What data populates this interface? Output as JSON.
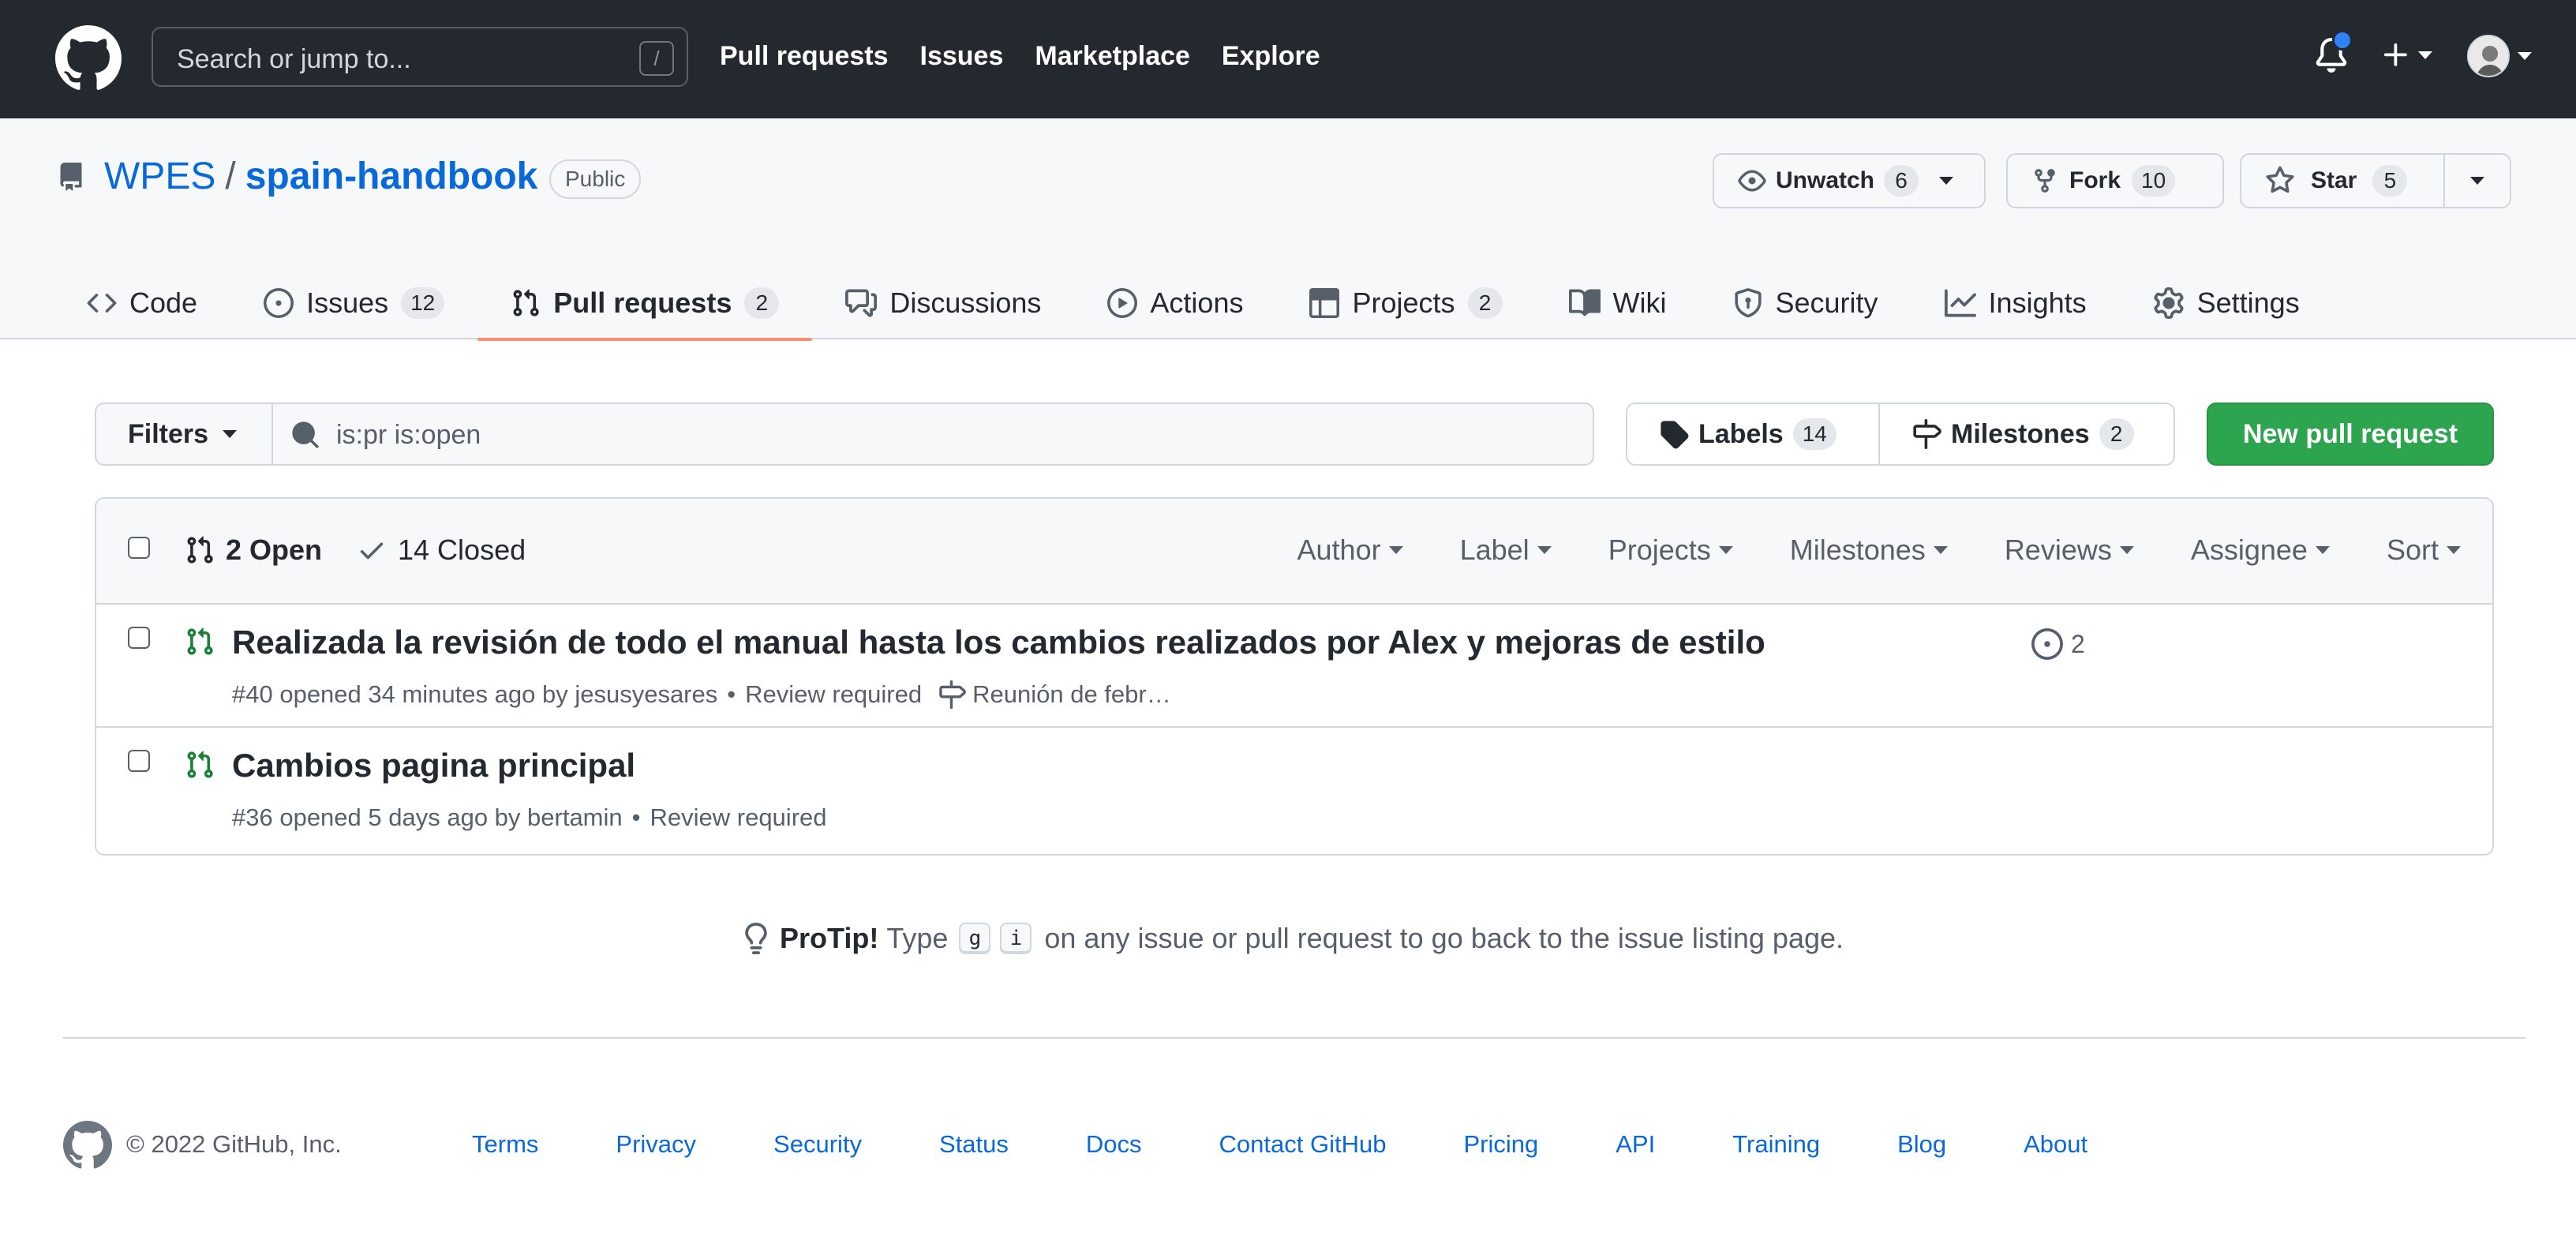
{
  "header": {
    "search_placeholder": "Search or jump to...",
    "search_shortcut": "/",
    "nav": [
      "Pull requests",
      "Issues",
      "Marketplace",
      "Explore"
    ]
  },
  "repo": {
    "owner": "WPES",
    "separator": "/",
    "name": "spain-handbook",
    "visibility": "Public",
    "watch": {
      "label": "Unwatch",
      "count": "6"
    },
    "fork": {
      "label": "Fork",
      "count": "10"
    },
    "star": {
      "label": "Star",
      "count": "5"
    }
  },
  "tabs": [
    {
      "label": "Code",
      "count": "",
      "icon": "code-icon"
    },
    {
      "label": "Issues",
      "count": "12",
      "icon": "issue-opened-icon"
    },
    {
      "label": "Pull requests",
      "count": "2",
      "icon": "git-pull-request-icon",
      "active": true
    },
    {
      "label": "Discussions",
      "count": "",
      "icon": "comment-discussion-icon"
    },
    {
      "label": "Actions",
      "count": "",
      "icon": "play-icon"
    },
    {
      "label": "Projects",
      "count": "2",
      "icon": "table-icon"
    },
    {
      "label": "Wiki",
      "count": "",
      "icon": "book-icon"
    },
    {
      "label": "Security",
      "count": "",
      "icon": "shield-icon"
    },
    {
      "label": "Insights",
      "count": "",
      "icon": "graph-icon"
    },
    {
      "label": "Settings",
      "count": "",
      "icon": "gear-icon"
    }
  ],
  "subnav": {
    "filters_label": "Filters",
    "query": "is:pr is:open",
    "labels": {
      "label": "Labels",
      "count": "14"
    },
    "milestones": {
      "label": "Milestones",
      "count": "2"
    },
    "new_pr_label": "New pull request"
  },
  "list": {
    "open_label": "2 Open",
    "closed_label": "14 Closed",
    "sort_menus": [
      "Author",
      "Label",
      "Projects",
      "Milestones",
      "Reviews",
      "Assignee",
      "Sort"
    ],
    "items": [
      {
        "title": "Realizada la revisión de todo el manual hasta los cambios realizados por Alex y mejoras de estilo",
        "meta": "#40 opened 34 minutes ago by jesusyesares",
        "review": "Review required",
        "milestone": "Reunión de febr…",
        "linked_issues": "2"
      },
      {
        "title": "Cambios pagina principal",
        "meta": "#36 opened 5 days ago by bertamin",
        "review": "Review required"
      }
    ]
  },
  "protip": {
    "label": "ProTip!",
    "before": "Type",
    "key1": "g",
    "key2": "i",
    "after": "on any issue or pull request to go back to the issue listing page."
  },
  "footer": {
    "copyright": "© 2022 GitHub, Inc.",
    "links": [
      "Terms",
      "Privacy",
      "Security",
      "Status",
      "Docs",
      "Contact GitHub",
      "Pricing",
      "API",
      "Training",
      "Blog",
      "About"
    ]
  },
  "colors": {
    "header_bg": "#24292f",
    "link": "#0969da",
    "primary_button": "#2da44e",
    "open_icon": "#1a7f37",
    "active_tab_underline": "#fd8c73",
    "notification_dot": "#2f81f7"
  }
}
